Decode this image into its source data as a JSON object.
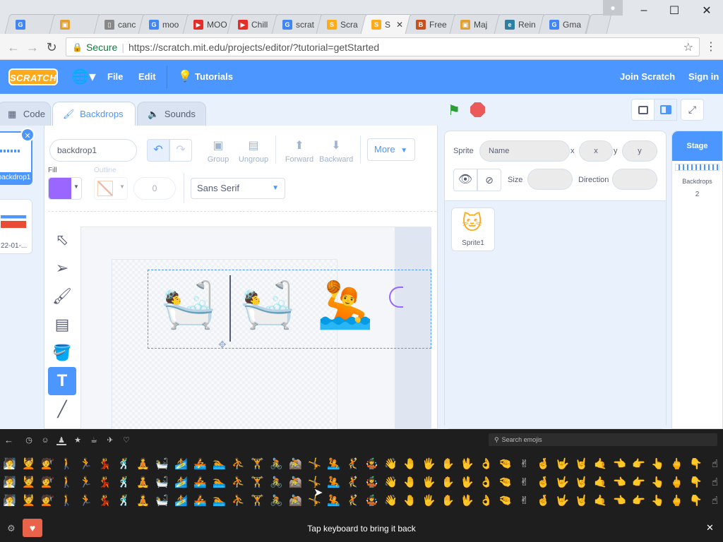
{
  "browser": {
    "tabs": [
      {
        "label": "",
        "icon": "google-icon"
      },
      {
        "label": "",
        "icon": "app-icon"
      },
      {
        "label": "canc",
        "icon": "doc-icon"
      },
      {
        "label": "moo",
        "icon": "google-icon"
      },
      {
        "label": "MOO",
        "icon": "youtube-icon"
      },
      {
        "label": "Chill",
        "icon": "youtube-icon"
      },
      {
        "label": "scrat",
        "icon": "google-icon"
      },
      {
        "label": "Scra",
        "icon": "scratch-icon"
      },
      {
        "label": "S",
        "icon": "scratch-icon"
      },
      {
        "label": "Free",
        "icon": "blog-icon"
      },
      {
        "label": "Maj",
        "icon": "app-icon"
      },
      {
        "label": "Rein",
        "icon": "e-icon"
      },
      {
        "label": "Gma",
        "icon": "google-icon"
      }
    ],
    "secure_label": "Secure",
    "url": "https://scratch.mit.edu/projects/editor/?tutorial=getStarted"
  },
  "scratch": {
    "logo": "SCRATCH",
    "menu": {
      "file": "File",
      "edit": "Edit",
      "tutorials": "Tutorials",
      "join": "Join Scratch",
      "signin": "Sign in"
    },
    "tabs": {
      "code": "Code",
      "backdrops": "Backdrops",
      "sounds": "Sounds"
    },
    "backdrop_list": [
      {
        "label": "backdrop1",
        "index": "1"
      },
      {
        "label": "22-01-...",
        "index": "2"
      }
    ],
    "paint": {
      "name": "backdrop1",
      "group": "Group",
      "ungroup": "Ungroup",
      "forward": "Forward",
      "backward": "Backward",
      "more": "More",
      "fill_label": "Fill",
      "outline_label": "Outline",
      "outline_value": "0",
      "font": "Sans Serif",
      "fill_color": "#9966ff"
    },
    "sprite_info": {
      "sprite_label": "Sprite",
      "name_placeholder": "Name",
      "x_label": "x",
      "x_placeholder": "x",
      "y_label": "y",
      "y_placeholder": "y",
      "size_label": "Size",
      "direction_label": "Direction"
    },
    "sprites": [
      {
        "name": "Sprite1"
      }
    ],
    "stage": {
      "title": "Stage",
      "backdrops_label": "Backdrops",
      "backdrops_count": "2"
    }
  },
  "emoji_panel": {
    "search_placeholder": "Search emojis",
    "hint": "Tap keyboard to bring it back",
    "rows": [
      [
        "🧖",
        "💆",
        "💇",
        "🚶",
        "🏃",
        "💃",
        "🕺",
        "🧘",
        "🛀",
        "🏄",
        "🚣",
        "🏊",
        "⛹",
        "🏋",
        "🚴",
        "🚵",
        "🤸",
        "🤽",
        "🤾",
        "🤹",
        "👋",
        "🤚",
        "🖐",
        "✋",
        "🖖",
        "👌",
        "🤏",
        "✌",
        "🤞",
        "🤟",
        "🤘",
        "🤙",
        "👈",
        "👉",
        "👆",
        "🖕",
        "👇",
        "☝",
        "👍",
        "👎",
        "✊"
      ],
      [
        "🧖",
        "💆",
        "💇",
        "🚶",
        "🏃",
        "💃",
        "🕺",
        "🧘",
        "🛀",
        "🏄",
        "🚣",
        "🏊",
        "⛹",
        "🏋",
        "🚴",
        "🚵",
        "🤸",
        "🤽",
        "🤾",
        "🤹",
        "👋",
        "🤚",
        "🖐",
        "✋",
        "🖖",
        "👌",
        "🤏",
        "✌",
        "🤞",
        "🤟",
        "🤘",
        "🤙",
        "👈",
        "👉",
        "👆",
        "🖕",
        "👇",
        "☝",
        "👍",
        "👎",
        "✊"
      ],
      [
        "🧖",
        "💆",
        "💇",
        "🚶",
        "🏃",
        "💃",
        "🕺",
        "🧘",
        "🛀",
        "🏄",
        "🚣",
        "🏊",
        "⛹",
        "🏋",
        "🚴",
        "🚵",
        "🤸",
        "🤽",
        "🤾",
        "🤹",
        "👋",
        "🤚",
        "🖐",
        "✋",
        "🖖",
        "👌",
        "🤏",
        "✌",
        "🤞",
        "🤟",
        "🤘",
        "🤙",
        "👈",
        "👉",
        "👆",
        "🖕",
        "👇",
        "☝",
        "👍",
        "👎",
        "✊"
      ]
    ]
  },
  "canvas_emojis": [
    "🛀",
    "🛀",
    "🤽"
  ]
}
